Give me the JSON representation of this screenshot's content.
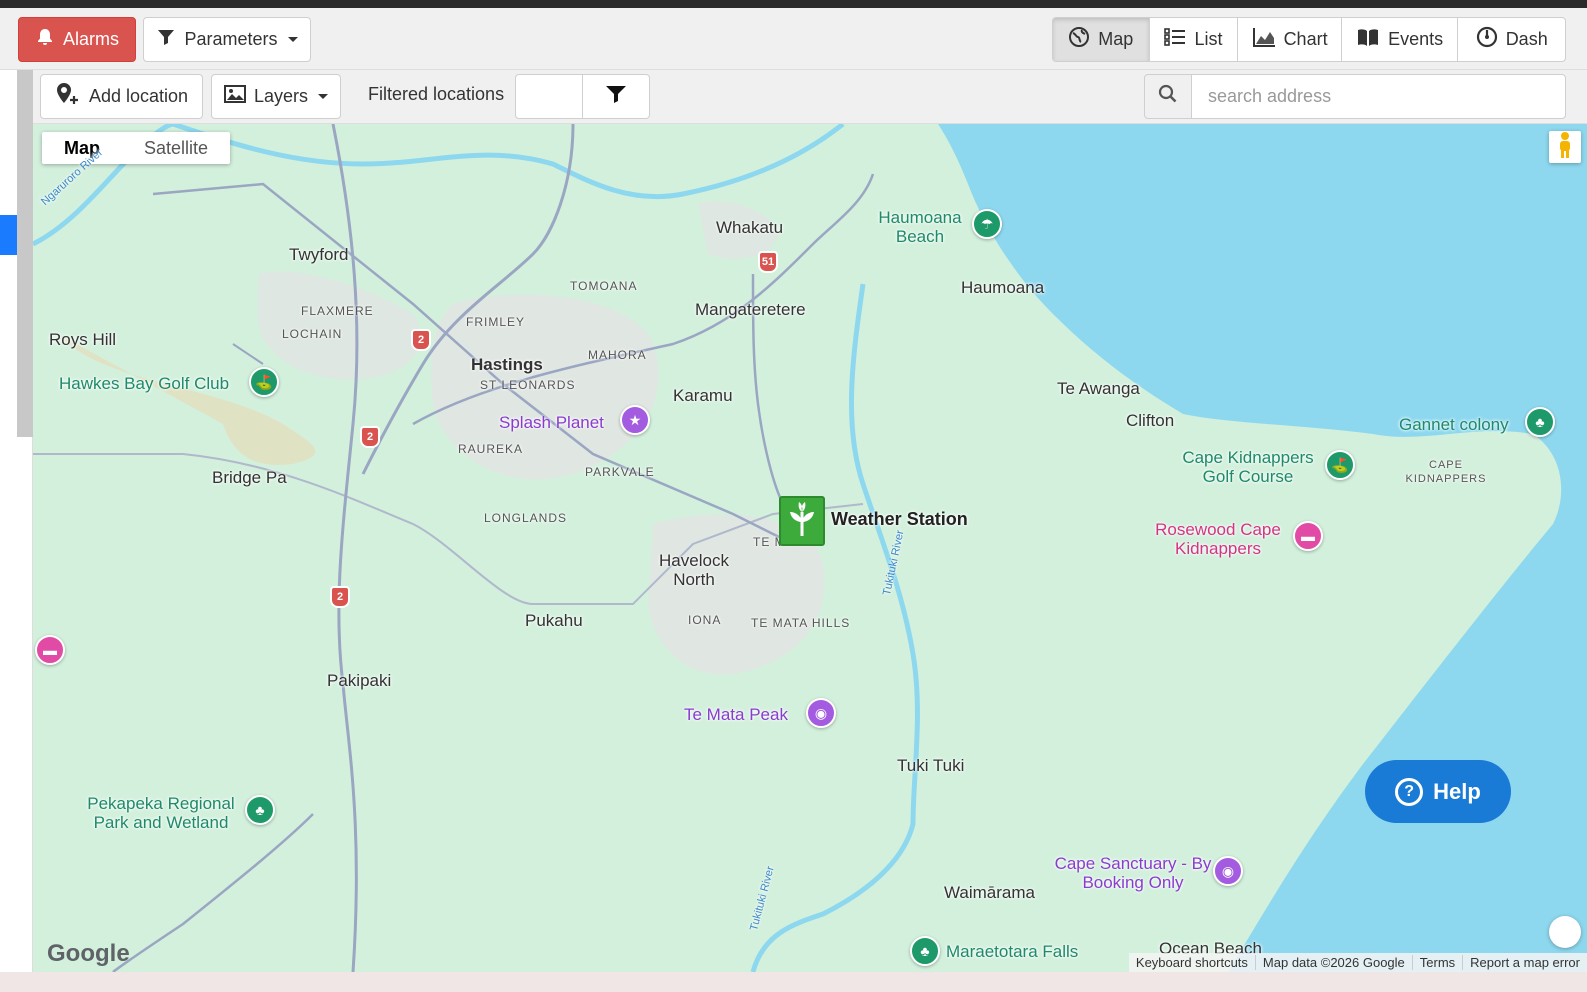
{
  "toolbar": {
    "alarms_label": "Alarms",
    "parameters_label": "Parameters",
    "views": [
      {
        "label": "Map",
        "icon": "globe-icon",
        "active": true
      },
      {
        "label": "List",
        "icon": "list-icon",
        "active": false
      },
      {
        "label": "Chart",
        "icon": "area-chart-icon",
        "active": false
      },
      {
        "label": "Events",
        "icon": "book-icon",
        "active": false
      },
      {
        "label": "Dash",
        "icon": "dashboard-icon",
        "active": false
      }
    ]
  },
  "subbar": {
    "add_location_label": "Add location",
    "layers_label": "Layers",
    "filtered_locations_label": "Filtered locations",
    "search_placeholder": "search address"
  },
  "map": {
    "type_map": "Map",
    "type_satellite": "Satellite",
    "places": [
      "Twyford",
      "FLAXMERE",
      "LOCHAIN",
      "Roys Hill",
      "Hastings",
      "ST LEONARDS",
      "FRIMLEY",
      "MAHORA",
      "TOMOANA",
      "Whakatu",
      "Mangateretere",
      "Karamu",
      "RAUREKA",
      "PARKVALE",
      "LONGLANDS",
      "Bridge Pa",
      "Havelock North",
      "IONA",
      "TE MATA HILLS",
      "Pukahu",
      "Pakipaki",
      "Haumoana",
      "Te Awanga",
      "Clifton",
      "CAPE KIDNAPPERS",
      "Tuki Tuki",
      "Waimārama",
      "Ocean Beach",
      "TE MATA"
    ],
    "pois": [
      {
        "name": "Hawkes Bay Golf Club",
        "kind": "golf"
      },
      {
        "name": "Splash Planet",
        "kind": "attraction"
      },
      {
        "name": "Haumoana Beach",
        "kind": "beach"
      },
      {
        "name": "Gannet colony",
        "kind": "park"
      },
      {
        "name": "Cape Kidnappers Golf Course",
        "kind": "golf"
      },
      {
        "name": "Rosewood Cape Kidnappers",
        "kind": "hotel"
      },
      {
        "name": "Te Mata Peak",
        "kind": "attraction"
      },
      {
        "name": "Pekapeka Regional Park and Wetland",
        "kind": "park"
      },
      {
        "name": "Cape Sanctuary - By Booking Only",
        "kind": "attraction"
      },
      {
        "name": "Maraetotara Falls",
        "kind": "park"
      }
    ],
    "rivers": [
      "Ngaruroro River",
      "Tukituki River",
      "Tukituki River"
    ],
    "highway_shields": [
      "51",
      "2",
      "2",
      "2"
    ],
    "marker_label": "Weather Station",
    "google_logo": "Google",
    "attribution": [
      "Keyboard shortcuts",
      "Map data ©2026 Google",
      "Terms",
      "Report a map error"
    ]
  },
  "help_label": "Help",
  "colors": {
    "alarm": "#d9534f",
    "land": "#d3f0dd",
    "water": "#8ed8ef",
    "marker": "#3cab3c",
    "help": "#1a7bd6"
  }
}
